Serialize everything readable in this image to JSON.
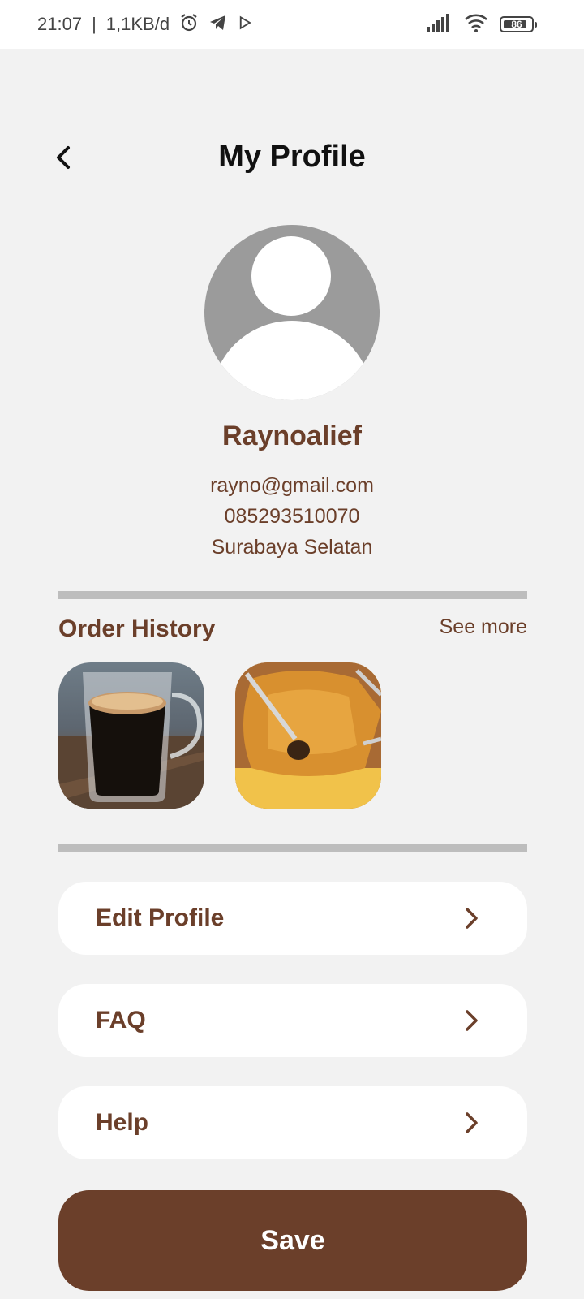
{
  "status_bar": {
    "time": "21:07",
    "separator": "|",
    "speed": "1,1KB/d",
    "battery": "86"
  },
  "header": {
    "title": "My Profile"
  },
  "profile": {
    "name": "Raynoalief",
    "email": "rayno@gmail.com",
    "phone": "085293510070",
    "location": "Surabaya Selatan"
  },
  "order_history": {
    "title": "Order History",
    "see_more": "See more",
    "items": [
      {
        "image": "coffee-glass-photo"
      },
      {
        "image": "fried-food-photo"
      }
    ]
  },
  "menu": {
    "items": [
      {
        "label": "Edit Profile"
      },
      {
        "label": "FAQ"
      },
      {
        "label": "Help"
      }
    ]
  },
  "actions": {
    "save_label": "Save"
  },
  "colors": {
    "brand_brown": "#6b3f2a",
    "background": "#f2f2f2",
    "divider": "#bdbdbd",
    "avatar_grey": "#9b9b9b"
  }
}
